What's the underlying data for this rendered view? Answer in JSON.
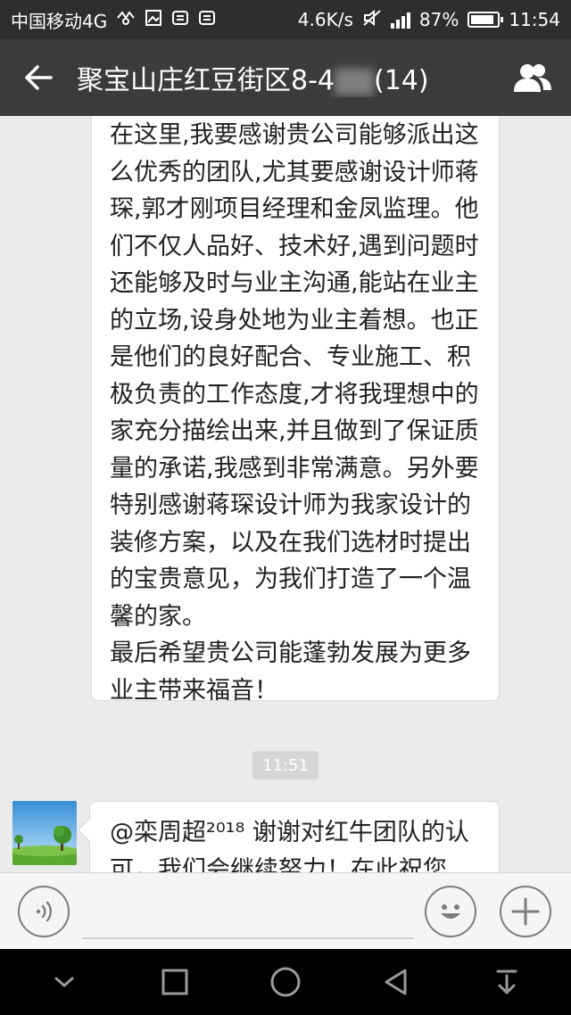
{
  "status_bar": {
    "carrier": "中国移动4G",
    "network_speed": "4.6K/s",
    "battery_percent": "87%",
    "battery_level": 0.87,
    "time": "11:54"
  },
  "header": {
    "title": "聚宝山庄红豆街区8-4",
    "count": "(14)"
  },
  "messages": [
    {
      "lines": [
        "在这里,我要感谢贵公司能够派出这",
        "么优秀的团队,尤其要感谢设计师蒋",
        "琛,郭才刚项目经理和金凤监理。他",
        "们不仅人品好、技术好,遇到问题时",
        "还能够及时与业主沟通,能站在业主",
        "的立场,设身处地为业主着想。也正",
        "是他们的良好配合、专业施工、积",
        "极负责的工作态度,才将我理想中的",
        "家充分描绘出来,并且做到了保证质",
        "量的承诺,我感到非常满意。另外要",
        "特别感谢蒋琛设计师为我家设计的",
        "装修方案，以及在我们选材时提出",
        "的宝贵意见，为我们打造了一个温",
        "馨的家。",
        "最后希望贵公司能蓬勃发展为更多",
        "业主带来福音！"
      ]
    },
    {
      "time": "11:51",
      "lines": [
        "@栾周超²⁰¹⁸ 谢谢对红牛团队的认",
        "可，我们会继续努力！在此祝您"
      ]
    }
  ],
  "input": {
    "value": ""
  },
  "colors": {
    "status_bar": "#2e2e2e",
    "title_bar": "#3b3b3b",
    "chat_bg": "#ebebeb",
    "bubble": "#ffffff",
    "nav_bar": "#000000"
  },
  "icons": [
    "back-arrow-icon",
    "group-members-icon",
    "voice-icon",
    "emoji-icon",
    "plus-icon",
    "nav-collapse-icon",
    "nav-recents-icon",
    "nav-home-icon",
    "nav-back-icon",
    "nav-notification-icon"
  ]
}
